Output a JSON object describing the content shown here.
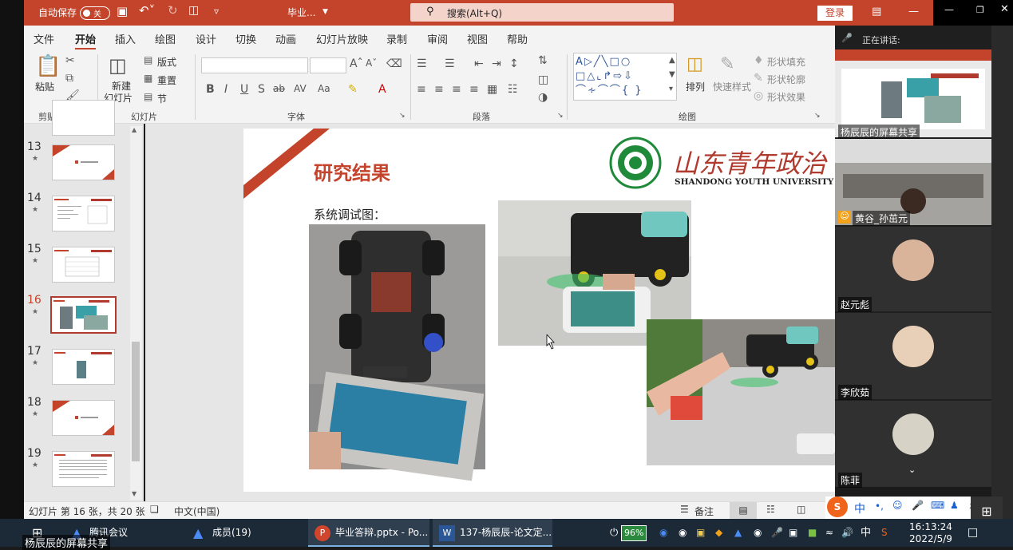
{
  "titlebar": {
    "autosave_label": "自动保存",
    "autosave_state": "关",
    "doc_name": "毕业...",
    "search_placeholder": "搜索(Alt+Q)",
    "signin_label": "登录"
  },
  "ribbon": {
    "tabs": [
      "文件",
      "开始",
      "插入",
      "绘图",
      "设计",
      "切换",
      "动画",
      "幻灯片放映",
      "录制",
      "审阅",
      "视图",
      "帮助"
    ],
    "clipboard": {
      "paste": "粘贴",
      "group": "剪贴板"
    },
    "slides": {
      "new_slide": "新建",
      "new_slide2": "幻灯片",
      "layout": "版式",
      "reset": "重置",
      "section": "节",
      "group": "幻灯片"
    },
    "font": {
      "group": "字体"
    },
    "paragraph": {
      "group": "段落"
    },
    "drawing": {
      "arrange": "排列",
      "quick_styles": "快速样式",
      "shape_fill": "形状填充",
      "shape_outline": "形状轮廓",
      "shape_effects": "形状效果",
      "group": "绘图"
    }
  },
  "thumbnails": [
    {
      "num": "13"
    },
    {
      "num": "14"
    },
    {
      "num": "15"
    },
    {
      "num": "16"
    },
    {
      "num": "17"
    },
    {
      "num": "18"
    },
    {
      "num": "19"
    }
  ],
  "slide": {
    "title": "研究结果",
    "subtitle": "系统调试图：",
    "university_cn": "山东青年政治",
    "university_en": "SHANDONG YOUTH UNIVERSITY OF POLITIC"
  },
  "statusbar": {
    "slide_info": "幻灯片 第 16 张，共 20 张",
    "language": "中文(中国)",
    "notes": "备注"
  },
  "meeting": {
    "speaking_label": "正在讲话:",
    "participants": [
      {
        "name": "杨辰辰的屏幕共享"
      },
      {
        "name": "黄谷_孙茁元"
      },
      {
        "name": "赵元彪"
      },
      {
        "name": "李欣茹"
      },
      {
        "name": "陈菲"
      }
    ]
  },
  "taskbar": {
    "items": [
      {
        "label": "腾讯会议"
      },
      {
        "label": "成员(19)"
      },
      {
        "label": "毕业答辩.pptx - Po..."
      },
      {
        "label": "137-杨辰辰-论文定..."
      }
    ],
    "battery": "96%",
    "ime_lang": "中",
    "time": "16:13:24",
    "date": "2022/5/9"
  },
  "bottom_share_label": "杨辰辰的屏幕共享",
  "colors": {
    "accent": "#c4432b",
    "taskbar": "#1c2a38"
  }
}
